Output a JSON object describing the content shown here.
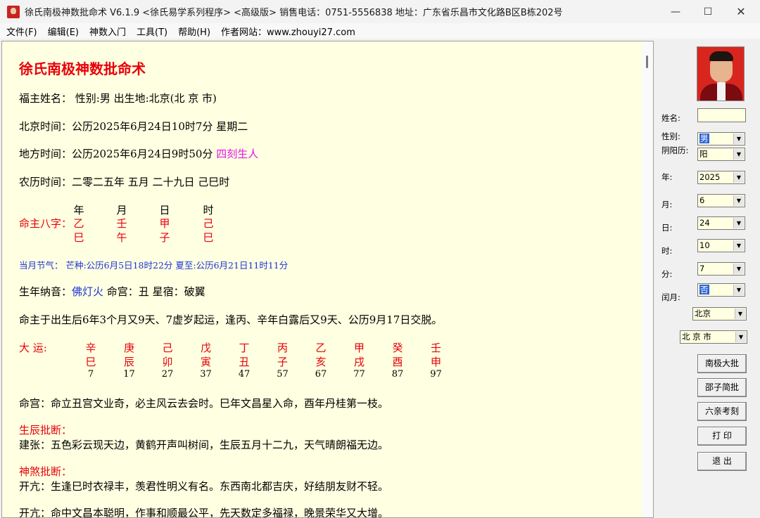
{
  "window": {
    "title": "徐氏南极神数批命术 V6.1.9 <徐氏易学系列程序> <高级版>   销售电话：0751-5556838   地址：广东省乐昌市文化路B区B栋202号",
    "minimize_glyph": "—",
    "maximize_glyph": "☐",
    "close_glyph": "✕"
  },
  "menu": [
    "文件(F)",
    "编辑(E)",
    "神数入门",
    "工具(T)",
    "帮助(H)",
    "作者网站：www.zhouyi27.com"
  ],
  "report": {
    "heading": "徐氏南极神数批命术",
    "line1": "福主姓名：  性别:男   出生地:北京(北 京 市)",
    "beijing_time": "北京时间：公历2025年6月24日10时7分  星期二",
    "local_time_prefix": "地方时间：公历2025年6月24日9时50分",
    "local_time_tag": "四刻生人",
    "lunar_time": "农历时间：二零二五年  五月  二十九日  己巳时",
    "bazi_label": "命主八字：",
    "bazi_headers": [
      "年",
      "月",
      "日",
      "时"
    ],
    "bazi_stems": [
      "乙",
      "壬",
      "甲",
      "己"
    ],
    "bazi_branches": [
      "巳",
      "午",
      "子",
      "巳"
    ],
    "solar_terms": "当月节气：  芒种:公历6月5日18时22分  夏至:公历6月21日11时11分",
    "nayin_prefix": "生年纳音：",
    "nayin_value": "佛灯火",
    "nayin_suffix": "   命宫：丑   星宿：破翼",
    "yun_start": "命主于出生后6年3个月又9天、7虚岁起运，逢丙、辛年白露后又9天、公历9月17日交脱。",
    "dayun_label": "大      运:",
    "dayun_stems": [
      "辛",
      "庚",
      "己",
      "戊",
      "丁",
      "丙",
      "乙",
      "甲",
      "癸",
      "壬"
    ],
    "dayun_branches": [
      "巳",
      "辰",
      "卯",
      "寅",
      "丑",
      "子",
      "亥",
      "戌",
      "酉",
      "申"
    ],
    "dayun_ages": [
      "7",
      "17",
      "27",
      "37",
      "47",
      "57",
      "67",
      "77",
      "87",
      "97"
    ],
    "minggong": "命宫：命立丑宫文业奇，必主风云去会时。巳年文昌星入命，酉年丹桂第一枝。",
    "shengchen_title": "生辰批断：",
    "shengchen_text": "建张：五色彩云现天边，黄鹤开声叫树间，生辰五月十二九，天气晴朗福无边。",
    "shensha_title": "神煞批断：",
    "shensha_text": "开亢：生逢巳时衣禄丰，羡君性明义有名。东西南北都吉庆，好结朋友财不轻。",
    "cut_line": "开亢：命中文昌本聪明，作事和顺最公平，先天数定多福禄，晚景荣华又大增。"
  },
  "form": {
    "name_label": "姓名:",
    "name_value": "",
    "gender_label": "性别:",
    "gender_value": "男",
    "calendar_label": "阴阳历:",
    "calendar_value": "阳",
    "year_label": "年:",
    "year_value": "2025",
    "month_label": "月:",
    "month_value": "6",
    "day_label": "日:",
    "day_value": "24",
    "hour_label": "时:",
    "hour_value": "10",
    "minute_label": "分:",
    "minute_value": "7",
    "leap_label": "闰月:",
    "leap_value": "否",
    "province_value": "北京",
    "city_value": "北 京 市"
  },
  "buttons": {
    "nanji": "南极大批",
    "shaozi": "邵子简批",
    "liuqin": "六亲考刻",
    "print": "打  印",
    "exit": "退  出"
  }
}
